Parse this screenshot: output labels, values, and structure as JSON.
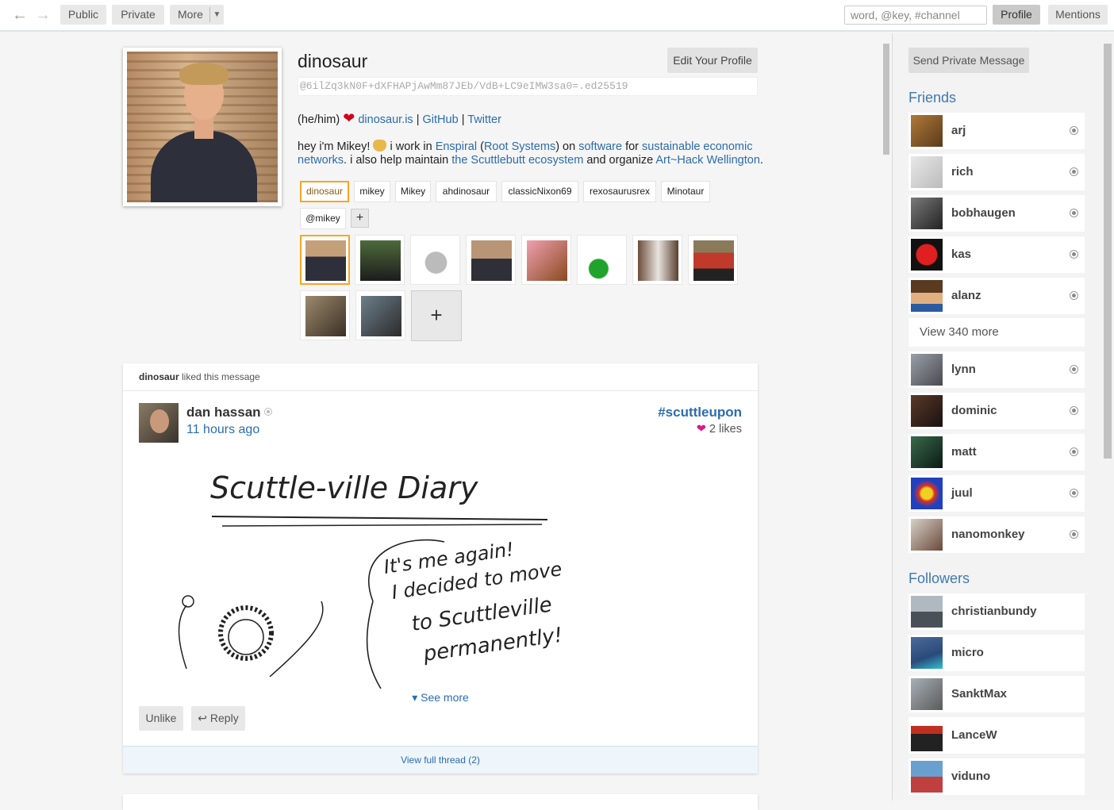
{
  "topbar": {
    "nav_public": "Public",
    "nav_private": "Private",
    "nav_more": "More",
    "search_placeholder": "word, @key, #channel",
    "profile_tab": "Profile",
    "mentions_tab": "Mentions"
  },
  "profile": {
    "name": "dinosaur",
    "edit_label": "Edit Your Profile",
    "feed_id": "@6ilZq3kN0F+dXFHAPjAwMm87JEb/VdB+LC9eIMW3sa0=.ed25519",
    "pronouns": "(he/him)",
    "links": {
      "site": "dinosaur.is",
      "sep1": "|",
      "github": "GitHub",
      "sep2": "|",
      "twitter": "Twitter"
    },
    "bio": {
      "t1": "hey i'm Mikey!",
      "t2": "i work in",
      "enspiral": "Enspiral",
      "p_open": "(",
      "root": "Root Systems",
      "t3": ") on",
      "software": "software",
      "t4": "for",
      "sustainable": "sustainable economic networks",
      "t5": ". i also help maintain",
      "scuttlebutt": "the Scuttlebutt ecosystem",
      "t6": "and organize",
      "arthack": "Art~Hack Wellington",
      "t7": "."
    },
    "names": [
      "dinosaur",
      "mikey",
      "Mikey",
      "ahdinosaur",
      "classicNixon69",
      "rexosaurusrex",
      "Minotaur",
      "@mikey"
    ],
    "add_name": "+",
    "add_image": "+"
  },
  "message": {
    "liker": "dinosaur",
    "liked_text": "liked this message",
    "author": "dan hassan",
    "time": "11 hours ago",
    "channel": "#scuttleupon",
    "likes": "2 likes",
    "drawing_title": "Scuttle-ville Diary",
    "drawing_line1": "It's me again!",
    "drawing_line2": "I decided to move",
    "drawing_line3": "to Scuttleville",
    "drawing_line4": "permanently!",
    "see_more": "▾ See more",
    "unlike": "Unlike",
    "reply": "↩ Reply",
    "thread": "View full thread (2)"
  },
  "sidebar": {
    "send_pm": "Send Private Message",
    "friends_heading": "Friends",
    "friends_top": [
      "arj",
      "rich",
      "bobhaugen",
      "kas",
      "alanz"
    ],
    "view_more": "View 340 more",
    "friends_bottom": [
      "lynn",
      "dominic",
      "matt",
      "juul",
      "nanomonkey"
    ],
    "followers_heading": "Followers",
    "followers": [
      "christianbundy",
      "micro",
      "SanktMax",
      "LanceW",
      "viduno"
    ]
  },
  "colors": {
    "accent": "#2b6cb0",
    "selected_border": "#f5a623",
    "heading": "#3f79b1",
    "like_heart": "#e0148a"
  }
}
